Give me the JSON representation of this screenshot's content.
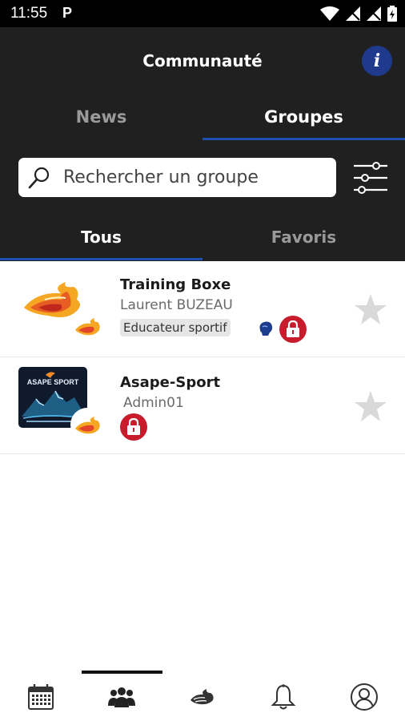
{
  "status_bar": {
    "time": "11:55",
    "notification_icon": "P"
  },
  "header": {
    "title": "Communauté",
    "info_label": "i"
  },
  "main_tabs": [
    {
      "label": "News",
      "active": false
    },
    {
      "label": "Groupes",
      "active": true
    }
  ],
  "search": {
    "placeholder": "Rechercher un groupe",
    "value": ""
  },
  "sub_tabs": [
    {
      "label": "Tous",
      "active": true
    },
    {
      "label": "Favoris",
      "active": false
    }
  ],
  "groups": [
    {
      "name": "Training Boxe",
      "owner": "Laurent BUZEAU",
      "tag": "Educateur sportif",
      "locked": true,
      "favorite": false
    },
    {
      "name": "Asape-Sport",
      "owner": "Admin01",
      "avatar_text": "ASAPE SPORT",
      "locked": true,
      "favorite": false
    }
  ],
  "bottom_nav": [
    {
      "icon": "calendar-icon",
      "active": false
    },
    {
      "icon": "groups-icon",
      "active": true
    },
    {
      "icon": "brand-logo-icon",
      "active": false
    },
    {
      "icon": "bell-icon",
      "active": false
    },
    {
      "icon": "profile-icon",
      "active": false
    }
  ],
  "colors": {
    "header_bg": "#202020",
    "accent_blue": "#1e4fb3",
    "lock_red": "#c81b2c",
    "info_blue": "#1f3a8c"
  }
}
